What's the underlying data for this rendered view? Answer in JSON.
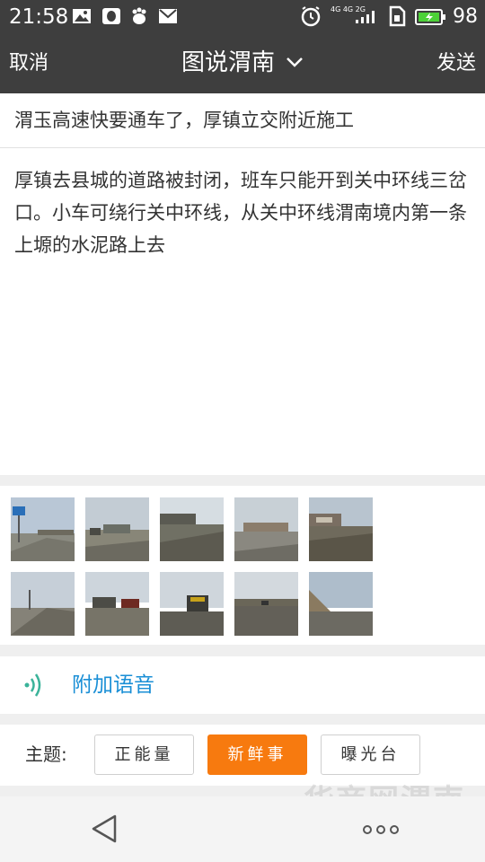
{
  "status_bar": {
    "time": "21:58",
    "network_label": "4G 4G 2G",
    "battery": "98",
    "icons": [
      "image-icon",
      "qq-icon",
      "baidu-paw-icon",
      "mail-icon",
      "alarm-icon",
      "signal-icon",
      "sim-icon",
      "battery-charging-icon"
    ]
  },
  "nav": {
    "cancel": "取消",
    "title": "图说渭南",
    "send": "发送"
  },
  "post": {
    "title": "渭玉高速快要通车了，厚镇立交附近施工",
    "body": "厚镇去县城的道路被封闭，班车只能开到关中环线三岔口。小车可绕行关中环线，从关中环线渭南境内第一条上塬的水泥路上去"
  },
  "photos": {
    "count": 10,
    "icon": "photo-thumbnail"
  },
  "voice": {
    "label": "附加语音",
    "icon": "voice-wave-icon"
  },
  "topic": {
    "label": "主题:",
    "options": [
      "正能量",
      "新鲜事",
      "曝光台"
    ],
    "selected": "新鲜事"
  },
  "watermark": "华商网渭南",
  "colors": {
    "bar": "#3e3e3e",
    "accent": "#f77a0f",
    "link": "#1a8fd6"
  }
}
